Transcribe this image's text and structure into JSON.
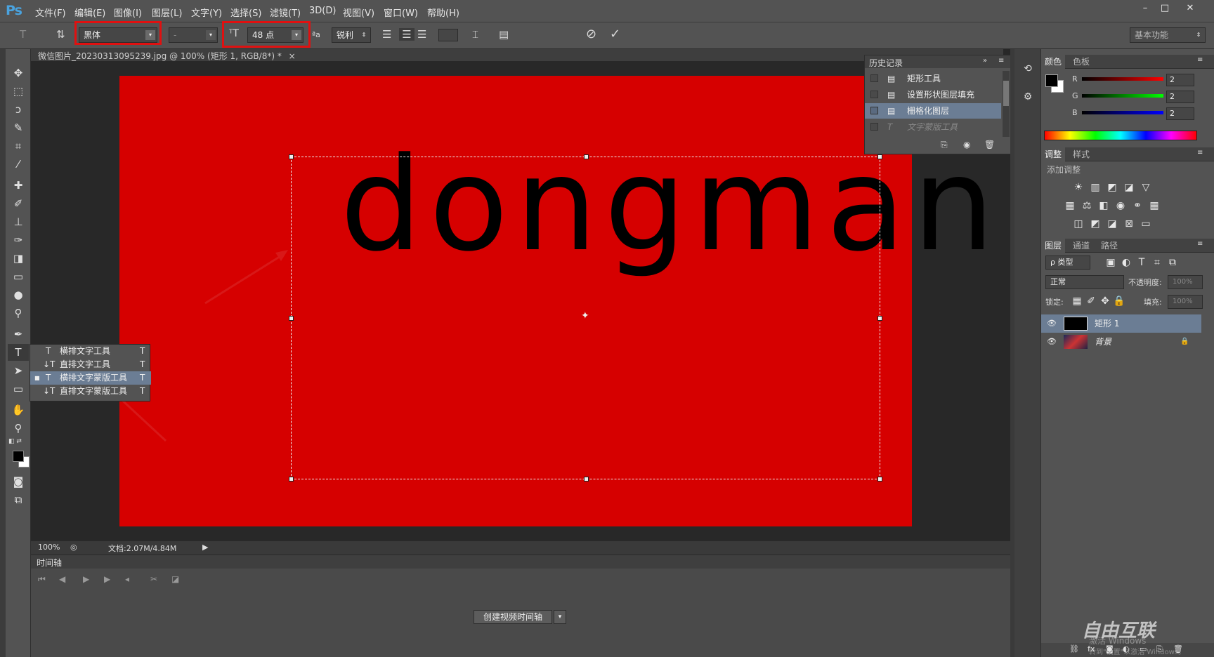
{
  "app": {
    "logo": "Ps"
  },
  "menu": [
    "文件(F)",
    "编辑(E)",
    "图像(I)",
    "图层(L)",
    "文字(Y)",
    "选择(S)",
    "滤镜(T)",
    "3D(D)",
    "视图(V)",
    "窗口(W)",
    "帮助(H)"
  ],
  "window_controls": {
    "minimize": "–",
    "maximize": "□",
    "close": "✕"
  },
  "options": {
    "font_family": "黑体",
    "font_style": "-",
    "font_size": "48 点",
    "aa_prefix": "ªa",
    "antialias": "锐利",
    "workspace": "基本功能",
    "cancel_icon": "⊘",
    "commit_icon": "✓"
  },
  "document": {
    "tab_label": "微信图片_20230313095239.jpg @ 100% (矩形 1, RGB/8*) *",
    "close": "×",
    "canvas_text": "dongman",
    "canvas_color": "#d60000"
  },
  "history": {
    "title": "历史记录",
    "items": [
      "矩形工具",
      "设置形状图层填充",
      "栅格化图层",
      "文字蒙版工具"
    ]
  },
  "context_menu": {
    "items": [
      {
        "label": "横排文字工具",
        "shortcut": "T",
        "icon": "T"
      },
      {
        "label": "直排文字工具",
        "shortcut": "T",
        "icon": "↓T"
      },
      {
        "label": "横排文字蒙版工具",
        "shortcut": "T",
        "icon": "T"
      },
      {
        "label": "直排文字蒙版工具",
        "shortcut": "T",
        "icon": "↓T"
      }
    ]
  },
  "status": {
    "zoom": "100%",
    "doc_size": "文档:2.07M/4.84M"
  },
  "timeline": {
    "title": "时间轴",
    "create_button": "创建视频时间轴",
    "dropdown": "▾"
  },
  "color_panel": {
    "tabs": [
      "颜色",
      "色板"
    ],
    "r_label": "R",
    "g_label": "G",
    "b_label": "B",
    "r": "2",
    "g": "2",
    "b": "2"
  },
  "adjust_panel": {
    "tabs": [
      "调整",
      "样式"
    ],
    "add_label": "添加调整"
  },
  "layers_panel": {
    "tabs": [
      "图层",
      "通道",
      "路径"
    ],
    "filter": "ρ 类型",
    "blend_mode": "正常",
    "opacity_label": "不透明度:",
    "opacity": "100%",
    "lock_label": "锁定:",
    "fill_label": "填充:",
    "fill": "100%",
    "layers": [
      {
        "name": "矩形 1",
        "selected": true
      },
      {
        "name": "背景",
        "selected": false
      }
    ]
  },
  "watermark": {
    "brand": "自由互联",
    "text": "激活 Windows",
    "sub": "转到\"设置\"以激活 Windows。"
  },
  "icons": {
    "text_tool": "T",
    "eye": "👁",
    "lock": "🔒",
    "play": "▶"
  }
}
